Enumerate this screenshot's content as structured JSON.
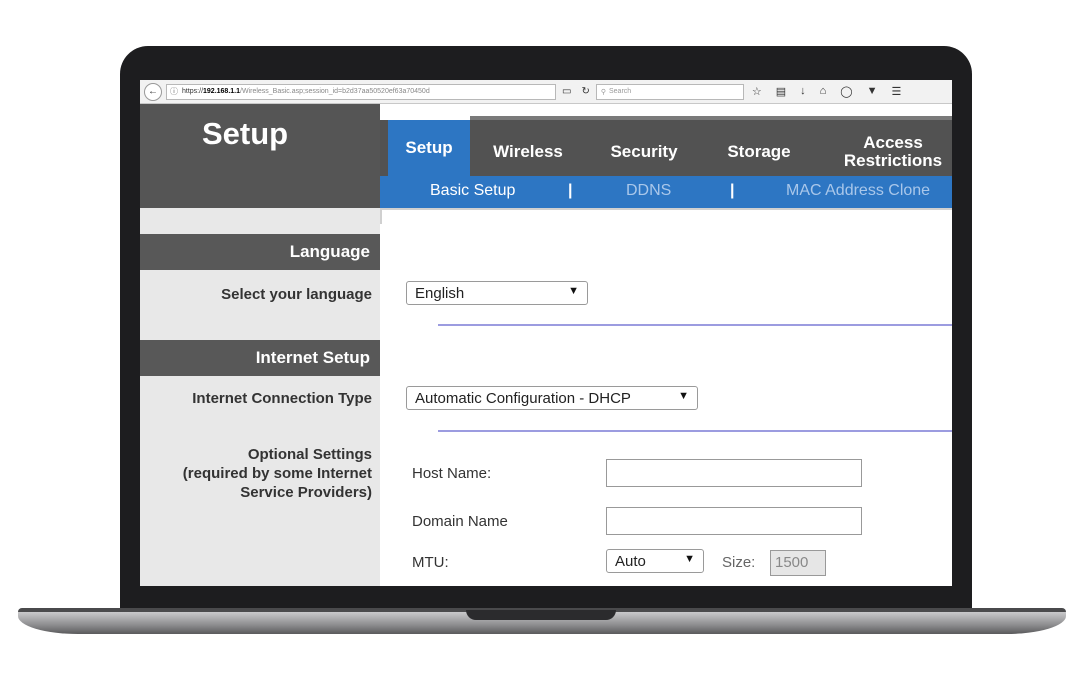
{
  "browser": {
    "url_scheme": "https://",
    "url_host": "192.168.1.1",
    "url_path": "/Wireless_Basic.asp;session_id=b2d37aa50520ef63a70450d",
    "search_placeholder": "Search"
  },
  "header": {
    "title": "Setup",
    "tabs": [
      {
        "label": "Setup"
      },
      {
        "label": "Wireless"
      },
      {
        "label": "Security"
      },
      {
        "label": "Storage"
      },
      {
        "label": "Access Restrictions"
      }
    ],
    "subtabs": [
      {
        "label": "Basic Setup"
      },
      {
        "label": "DDNS"
      },
      {
        "label": "MAC Address Clone"
      }
    ],
    "subtab_separator": "|"
  },
  "sections": {
    "language": {
      "heading": "Language",
      "select_label": "Select your language",
      "selected_value": "English"
    },
    "internet": {
      "heading": "Internet Setup",
      "connection_label": "Internet Connection Type",
      "connection_value": "Automatic Configuration - DHCP",
      "optional_label_line1": "Optional Settings",
      "optional_label_line2": "(required by some Internet",
      "optional_label_line3": "Service Providers)",
      "host_name_label": "Host Name:",
      "host_name_value": "",
      "domain_name_label": "Domain Name",
      "domain_name_value": "",
      "mtu_label": "MTU:",
      "mtu_value": "Auto",
      "size_label": "Size:",
      "size_value": "1500"
    }
  },
  "colors": {
    "accent_blue": "#2d76c3",
    "header_gray": "#555555",
    "divider_purple": "#9c9ce0"
  }
}
